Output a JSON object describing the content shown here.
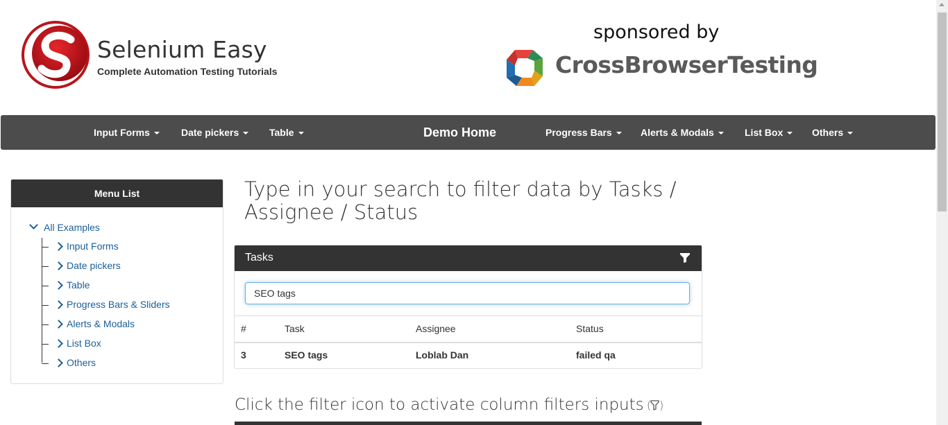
{
  "header": {
    "brand_title": "Selenium Easy",
    "brand_subtitle": "Complete Automation Testing Tutorials",
    "sponsored_text": "sponsored by",
    "sponsor_name": "CrossBrowserTesting"
  },
  "navbar": {
    "items": [
      {
        "label": "Input Forms"
      },
      {
        "label": "Date pickers"
      },
      {
        "label": "Table"
      },
      {
        "label": "Demo Home"
      },
      {
        "label": "Progress Bars"
      },
      {
        "label": "Alerts & Modals"
      },
      {
        "label": "List Box"
      },
      {
        "label": "Others"
      }
    ]
  },
  "sidebar": {
    "title": "Menu List",
    "root": "All Examples",
    "items": [
      {
        "label": "Input Forms"
      },
      {
        "label": "Date pickers"
      },
      {
        "label": "Table"
      },
      {
        "label": "Progress Bars & Sliders"
      },
      {
        "label": "Alerts & Modals"
      },
      {
        "label": "List Box"
      },
      {
        "label": "Others"
      }
    ]
  },
  "main": {
    "title": "Type in your search to filter data by Tasks / Assignee / Status",
    "panel_title": "Tasks",
    "search_value": "SEO tags",
    "columns": [
      "#",
      "Task",
      "Assignee",
      "Status"
    ],
    "rows": [
      [
        "3",
        "SEO tags",
        "Loblab Dan",
        "failed qa"
      ]
    ],
    "subtitle": "Click the filter icon to activate column filters inputs"
  },
  "icons": {
    "logo": "selenium-easy-logo-icon",
    "sponsor_logo": "crossbrowsertesting-logo-icon",
    "filter": "filter-icon"
  },
  "colors": {
    "navbar_bg": "#4c4c4c",
    "panel_head_bg": "#333333",
    "link": "#1a5f9a",
    "logo_red": "#c4141b"
  }
}
